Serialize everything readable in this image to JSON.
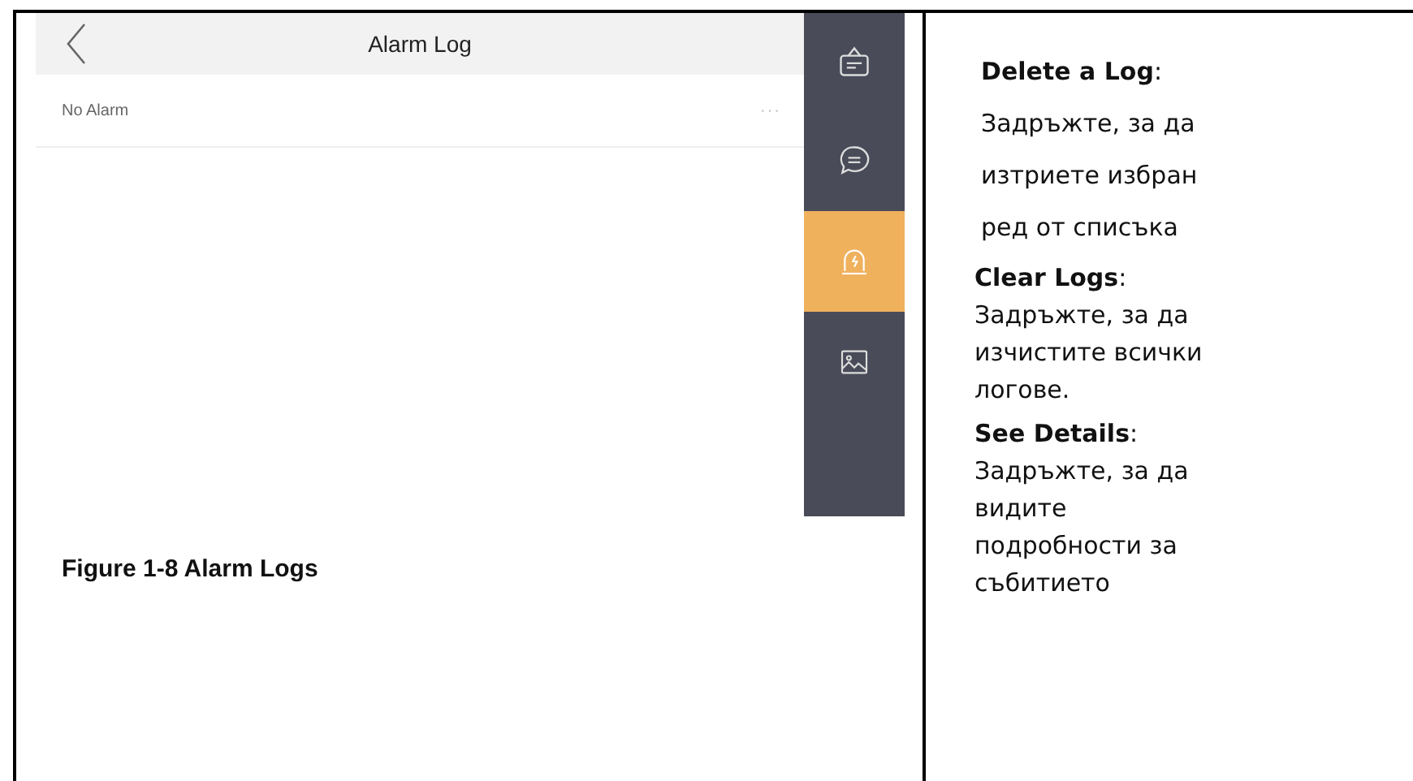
{
  "screen": {
    "title": "Alarm Log",
    "rows": [
      {
        "label": "No Alarm",
        "more": "···"
      }
    ],
    "sidebar": {
      "items": [
        {
          "kind": "notice",
          "selected": false
        },
        {
          "kind": "message",
          "selected": false
        },
        {
          "kind": "alarm",
          "selected": true
        },
        {
          "kind": "picture",
          "selected": false
        }
      ]
    }
  },
  "caption": "Figure 1-8 Alarm Logs",
  "notes": [
    {
      "term": "**Delete a Log**:",
      "text": "Задръжте, за да изтриете избран ред от списъка"
    },
    {
      "term": "**Clear Logs**:",
      "text": "Задръжте, за да изчистите всички логове."
    },
    {
      "term": "**See Details**:",
      "text": "Задръжте, за да видите подробности за събитието"
    }
  ]
}
